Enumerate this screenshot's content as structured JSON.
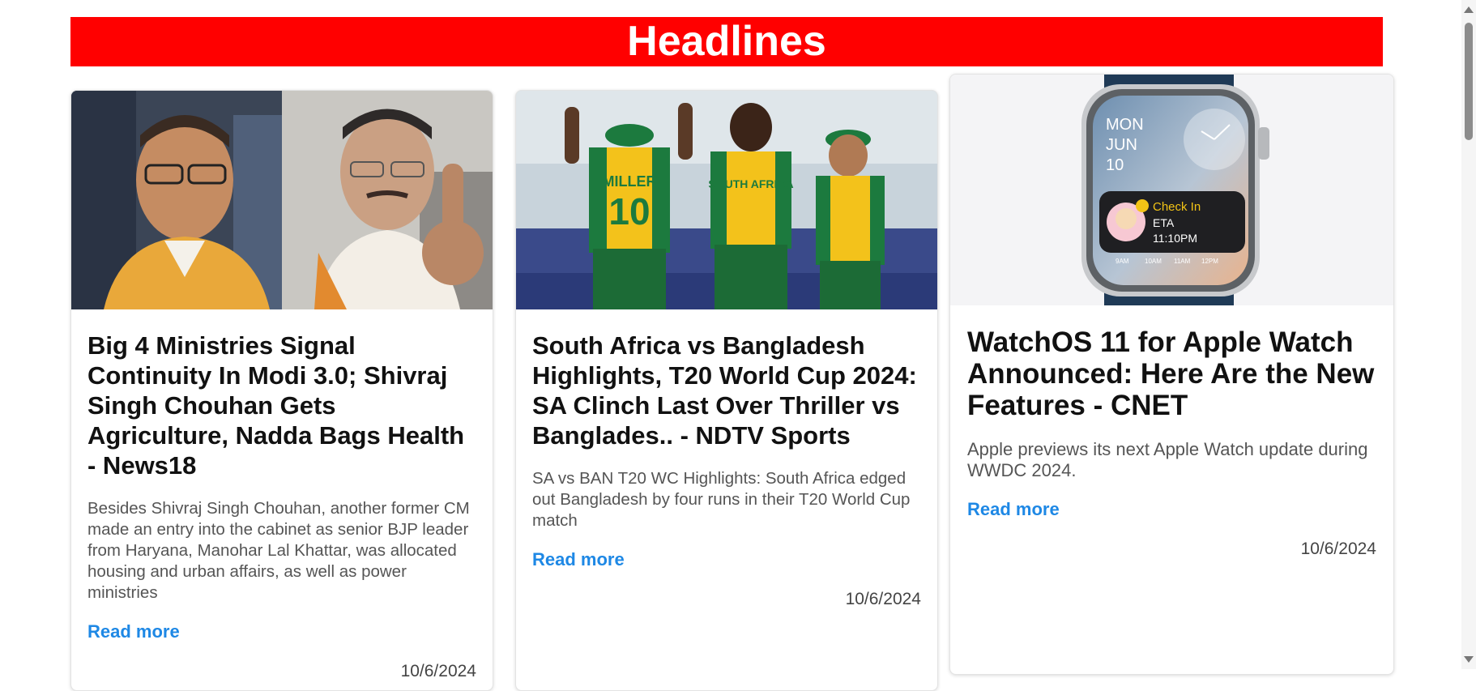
{
  "header": {
    "title": "Headlines",
    "color": "#ff0000"
  },
  "cards": [
    {
      "image_alt": "Shivraj Singh Chouhan and JP Nadda",
      "title": "Big 4 Ministries Signal Continuity In Modi 3.0; Shivraj Singh Chouhan Gets Agriculture, Nadda Bags Health - News18",
      "description": "Besides Shivraj Singh Chouhan, another former CM made an entry into the cabinet as senior BJP leader from Haryana, Manohar Lal Khattar, was allocated housing and urban affairs, as well as power ministries",
      "link_label": "Read more",
      "date": "10/6/2024"
    },
    {
      "image_alt": "South Africa cricket players celebrating",
      "image_text": {
        "player_name": "MILLER",
        "player_number": "10",
        "jersey_text": "SOUTH AFRICA"
      },
      "title": "South Africa vs Bangladesh Highlights, T20 World Cup 2024: SA Clinch Last Over Thriller vs Banglades.. - NDTV Sports",
      "description": "SA vs BAN T20 WC Highlights: South Africa edged out Bangladesh by four runs in their T20 World Cup match",
      "link_label": "Read more",
      "date": "10/6/2024"
    },
    {
      "image_alt": "Apple Watch showing watchOS 11",
      "watch": {
        "day": "MON",
        "month": "JUN",
        "date_num": "10",
        "checkin": "Check In",
        "eta_label": "ETA",
        "eta_time": "11:10PM",
        "hours": [
          "9AM",
          "10AM",
          "11AM",
          "12PM"
        ]
      },
      "title": "WatchOS 11 for Apple Watch Announced: Here Are the New Features - CNET",
      "description": "Apple previews its next Apple Watch update during WWDC 2024.",
      "link_label": "Read more",
      "date": "10/6/2024"
    }
  ],
  "colors": {
    "link": "#1e88e5"
  }
}
